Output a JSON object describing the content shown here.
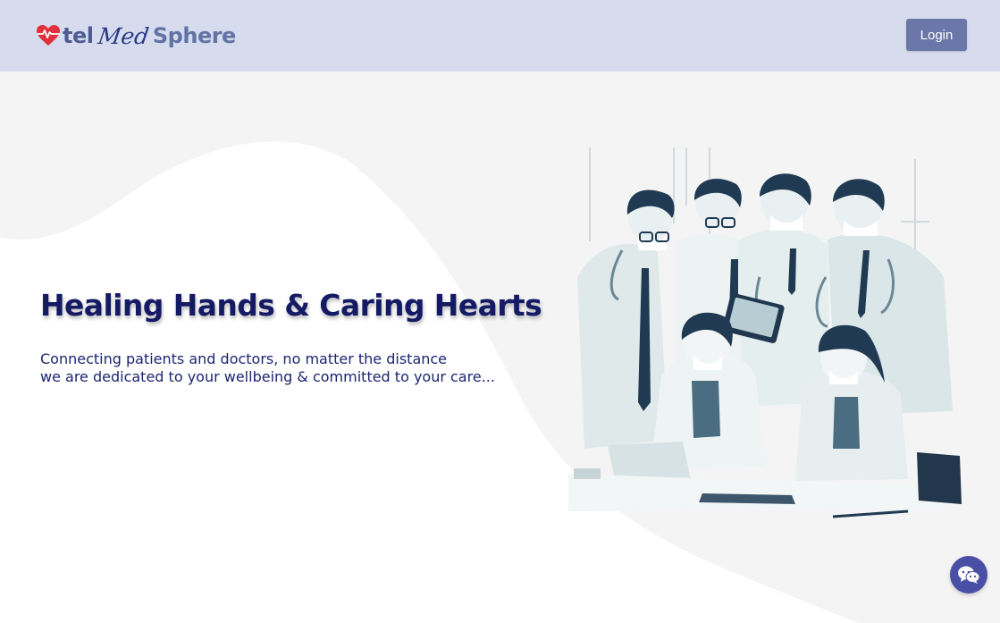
{
  "brand": {
    "name_part_1": "tel",
    "name_part_2": "Med",
    "name_part_3": "Sphere",
    "icon": "heart-pulse-icon",
    "colors": {
      "primary": "#4e5b92",
      "script": "#2b3a86",
      "heart": "#e0303b"
    }
  },
  "header": {
    "login_label": "Login",
    "background": "#d6dcee",
    "button_color": "#6a77a8"
  },
  "hero": {
    "title": "Healing Hands & Caring Hearts",
    "subtitle_line_1": "Connecting patients and doctors, no matter the distance",
    "subtitle_line_2": "we are dedicated to your wellbeing & committed to your care...",
    "title_color": "#141a64"
  },
  "chat": {
    "icon": "wechat-icon",
    "color": "#4a4fa6"
  }
}
